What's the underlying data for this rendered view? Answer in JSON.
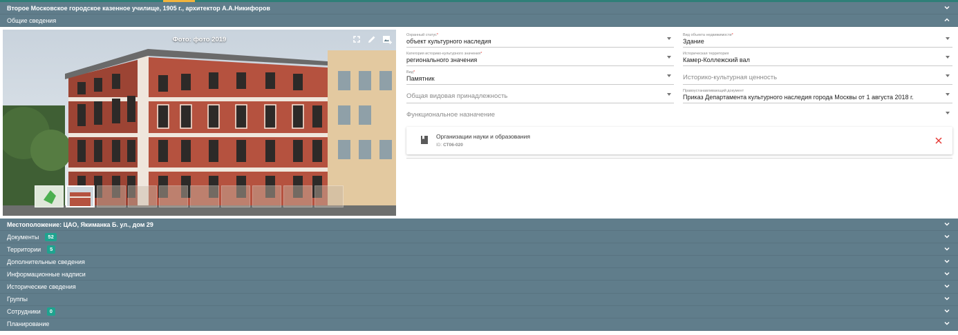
{
  "header": {
    "title": "Второе Московское городское казенное училище, 1905 г., архитектор А.А.Никифоров",
    "general_section": "Общие сведения"
  },
  "photo": {
    "title": "Фото: фото 2019",
    "tools": [
      "fullscreen-icon",
      "edit-icon",
      "add-photo-icon"
    ],
    "thumbnails_count": 10,
    "active_thumbnail": 2
  },
  "form": {
    "protection_status": {
      "label": "Охранный статус",
      "value": "объект культурного наследия"
    },
    "property_type": {
      "label": "Вид объекта недвижимости",
      "value": "Здание"
    },
    "category": {
      "label": "Категория историко-культурного значения",
      "value": "регионального значения"
    },
    "historical_territory": {
      "label": "Историческая территория",
      "value": "Камер-Коллежский вал"
    },
    "kind": {
      "label": "Вид",
      "value": "Памятник"
    },
    "cultural_value": {
      "placeholder": "Историко-культурная ценность"
    },
    "general_affiliation": {
      "placeholder": "Общая видовая принадлежность"
    },
    "legal_document": {
      "label": "Правоустанавливающий документ",
      "value": "Приказ Департамента культурного наследия города Москвы от 1 августа 2018 г."
    },
    "functional_purpose": {
      "placeholder": "Функциональное назначение"
    },
    "required_mark": "*"
  },
  "function_card": {
    "name": "Организации науки и образования",
    "id_label": "ID:",
    "id_value": "СТ06-020"
  },
  "sections": [
    {
      "label": "Местоположение: ЦАО, Якиманка Б. ул., дом 29",
      "bold": true
    },
    {
      "label": "Документы",
      "badge": "52"
    },
    {
      "label": "Территории",
      "badge": "5"
    },
    {
      "label": "Дополнительные сведения"
    },
    {
      "label": "Информационные надписи"
    },
    {
      "label": "Исторические сведения"
    },
    {
      "label": "Группы"
    },
    {
      "label": "Сотрудники",
      "badge": "0"
    },
    {
      "label": "Планирование"
    }
  ],
  "colors": {
    "bar": "#607d8b",
    "accent": "#2f7f78",
    "badge": "#1fa38f",
    "close": "#e53935"
  }
}
